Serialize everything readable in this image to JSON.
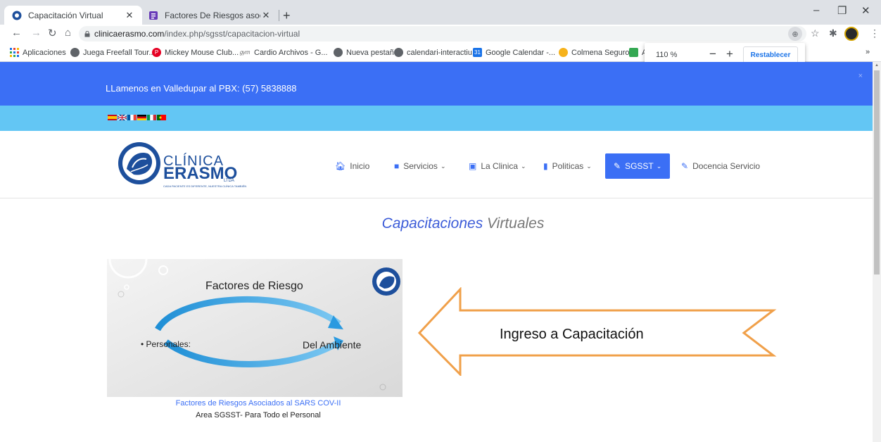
{
  "browser": {
    "tabs": [
      {
        "title": "Capacitación Virtual",
        "active": true
      },
      {
        "title": "Factores De Riesgos asociados al",
        "active": false
      }
    ],
    "new_tab_icon": "plus-icon",
    "url_host": "clinicaerasmo.com",
    "url_path": "/index.php/sgsst/capacitacion-virtual",
    "bookmarks": [
      {
        "label": "Aplicaciones",
        "icon": "apps-grid-icon"
      },
      {
        "label": "Juega Freefall Tour...",
        "icon": "globe-icon"
      },
      {
        "label": "Mickey Mouse Club...",
        "icon": "pinterest-icon"
      },
      {
        "label": "Cardio Archivos - G...",
        "icon": "gym-icon"
      },
      {
        "label": "Nueva pestaña",
        "icon": "globe-icon"
      },
      {
        "label": "calendari-interactiu...",
        "icon": "globe-icon"
      },
      {
        "label": "Google Calendar -...",
        "icon": "calendar-icon"
      },
      {
        "label": "Colmena Seguros",
        "icon": "colmena-icon"
      },
      {
        "label": "A",
        "icon": "green-icon"
      }
    ],
    "zoom_popup": {
      "percent": "110 %",
      "reset_label": "Restablecer"
    }
  },
  "site": {
    "topbar": {
      "phone_text": "LLamenos en Valledupar al PBX: (57) 5838888",
      "close": "×"
    },
    "logo": {
      "line1": "CLÍNICA",
      "line2": "ERASMO",
      "suffix": "LTDA",
      "tagline": "CADA PACIENTE ES DIFERENTE, NUESTRA CLÍNICA TAMBIÉN"
    },
    "nav": [
      {
        "label": "Inicio",
        "icon": "home-icon"
      },
      {
        "label": "Servicios",
        "icon": "briefcase-icon",
        "dropdown": true
      },
      {
        "label": "La Clinica",
        "icon": "building-icon",
        "dropdown": true
      },
      {
        "label": "Politicas",
        "icon": "file-icon",
        "dropdown": true
      },
      {
        "label": "SGSST",
        "icon": "edit-icon",
        "dropdown": true,
        "active": true
      },
      {
        "label": "Docencia Servicio",
        "icon": "edit-icon"
      }
    ],
    "title_accent": "Capacitaciones",
    "title_rest": " Virtuales",
    "slide": {
      "title": "Factores de Riesgo",
      "left": "• Personales:",
      "right": "Del Ambiente"
    },
    "caption_link": "Factores de Riesgos Asociados al SARS COV-II",
    "caption_sub": "Area SGSST- Para Todo el Personal",
    "arrow_label": "Ingreso a Capacitación"
  },
  "colors": {
    "brand_blue": "#3b6ff5",
    "light_blue": "#63c6f4",
    "arrow_orange": "#f0a04a"
  }
}
